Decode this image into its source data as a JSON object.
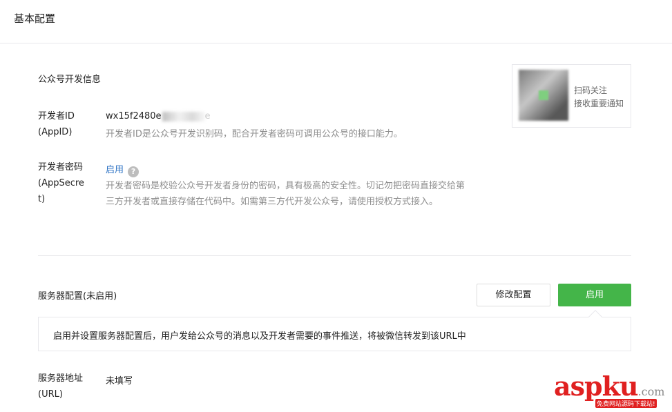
{
  "header": {
    "title": "基本配置"
  },
  "dev_info": {
    "title": "公众号开发信息",
    "appid": {
      "label_line1": "开发者ID",
      "label_line2": "(AppID)",
      "value_visible": "wx15f2480e",
      "value_hidden_tail": "e",
      "desc": "开发者ID是公众号开发识别码，配合开发者密码可调用公众号的接口能力。"
    },
    "secret": {
      "label_line1": "开发者密码",
      "label_line2": "(AppSecre",
      "label_line3": "t)",
      "action": "启用",
      "help_glyph": "?",
      "desc_line1": "开发者密码是校验公众号开发者身份的密码，具有极高的安全性。切记勿把密码直接交给第",
      "desc_line2": "三方开发者或直接存储在代码中。如需第三方代开发公众号，请使用授权方式接入。"
    },
    "qr": {
      "text_line1": "扫码关注",
      "text_line2": "接收重要通知"
    }
  },
  "server": {
    "title": "服务器配置(未启用)",
    "modify_button": "修改配置",
    "enable_button": "启用",
    "tip": "启用并设置服务器配置后，用户发给公众号的消息以及开发者需要的事件推送，将被微信转发到该URL中",
    "url": {
      "label_line1": "服务器地址",
      "label_line2": "(URL)",
      "value": "未填写"
    }
  },
  "watermark": {
    "asp": "asp",
    "ku": "ku",
    "com": ".com",
    "sub": "免费网站源码下载站!"
  },
  "colors": {
    "primary_green": "#44b549",
    "link_blue": "#2c72c4",
    "watermark_red": "#e02020"
  }
}
